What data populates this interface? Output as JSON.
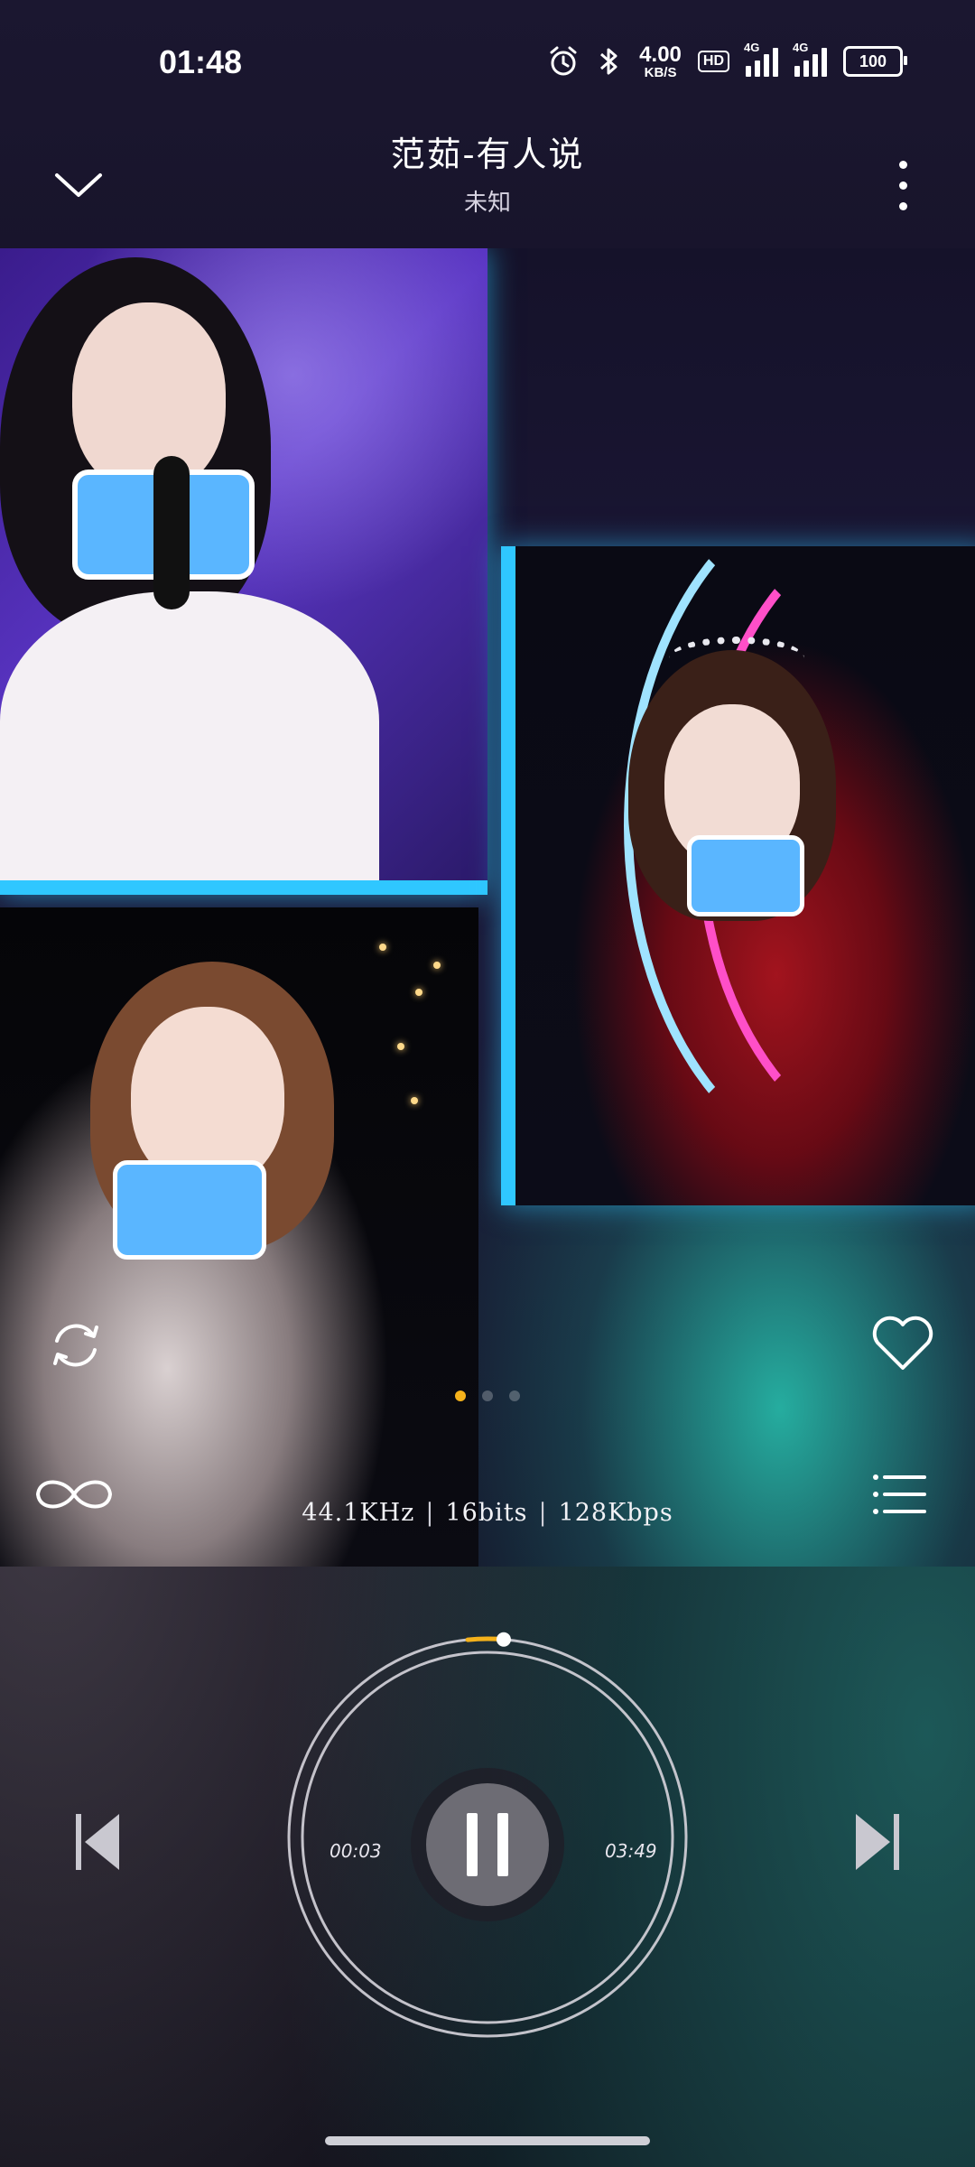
{
  "status_bar": {
    "time": "01:48",
    "net_speed_value": "4.00",
    "net_speed_unit": "KB/S",
    "hd_label": "HD",
    "signal1_label": "4G",
    "signal2_label": "4G",
    "battery": "100"
  },
  "header": {
    "title": "范茹-有人说",
    "artist": "未知"
  },
  "artwork": {
    "page_count": 3,
    "active_page": 1
  },
  "audio_info": {
    "sample_rate": "44.1KHz",
    "bit_depth": "16bits",
    "bitrate": "128Kbps",
    "separator": "|"
  },
  "player": {
    "elapsed": "00:03",
    "total": "03:49",
    "progress_fraction": 0.013,
    "state": "playing"
  },
  "colors": {
    "accent": "#f5b21b",
    "ring": "#d6d4dc"
  }
}
